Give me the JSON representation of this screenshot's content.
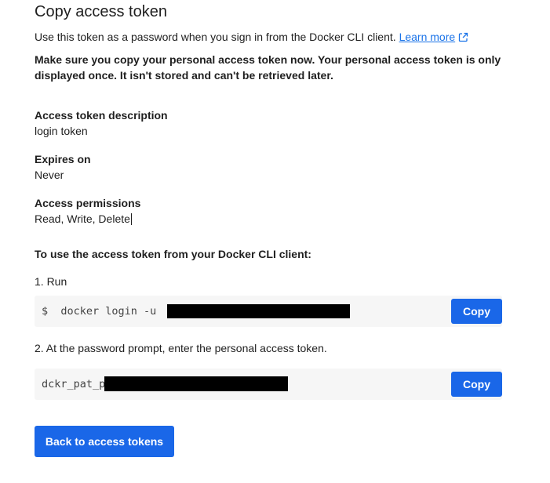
{
  "title": "Copy access token",
  "intro": {
    "text": "Use this token as a password when you sign in from the Docker CLI client. ",
    "learn_more": "Learn more",
    "learn_more_icon": "external-link-icon"
  },
  "warning": "Make sure you copy your personal access token now. Your personal access token is only displayed once. It isn't stored and can't be retrieved later.",
  "fields": {
    "description": {
      "label": "Access token description",
      "value": "login token"
    },
    "expires": {
      "label": "Expires on",
      "value": "Never"
    },
    "permissions": {
      "label": "Access permissions",
      "value": "Read, Write, Delete"
    }
  },
  "instructions": {
    "heading": "To use the access token from your Docker CLI client:",
    "step1": {
      "label": "1. Run",
      "code": "$  docker login -u ",
      "copy_label": "Copy"
    },
    "step2": {
      "label": "2. At the password prompt, enter the personal access token.",
      "code": "dckr_pat_p",
      "copy_label": "Copy"
    }
  },
  "back_button": "Back to access tokens",
  "colors": {
    "accent": "#1a67e8",
    "link": "#1a73e8",
    "code_background": "#f6f6f6"
  }
}
